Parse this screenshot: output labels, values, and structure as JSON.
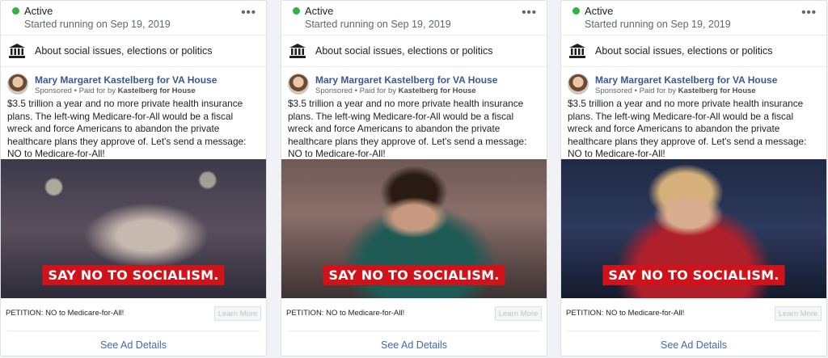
{
  "cards": [
    {
      "status": "Active",
      "started": "Started running on Sep 19, 2019",
      "more_label": "•••",
      "category": "About social issues, elections or politics",
      "advertiser": "Mary Margaret Kastelberg for VA House",
      "sponsored": "Sponsored",
      "paid_prefix": "Paid for by",
      "paid_by": "Kastelberg for House",
      "body": "$3.5 trillion a year and no more private health insurance plans. The left-wing Medicare-for-All would be a fiscal wreck and force Americans to abandon the private healthcare plans they approve of. Let's send a message: NO to Medicare-for-All!",
      "image_caption": "SAY NO TO SOCIALISM.",
      "cta_text": "PETITION: NO to Medicare-for-All!",
      "cta_button": "Learn More",
      "details_link": "See Ad Details"
    },
    {
      "status": "Active",
      "started": "Started running on Sep 19, 2019",
      "more_label": "•••",
      "category": "About social issues, elections or politics",
      "advertiser": "Mary Margaret Kastelberg for VA House",
      "sponsored": "Sponsored",
      "paid_prefix": "Paid for by",
      "paid_by": "Kastelberg for House",
      "body": "$3.5 trillion a year and no more private health insurance plans. The left-wing Medicare-for-All would be a fiscal wreck and force Americans to abandon the private healthcare plans they approve of. Let's send a message: NO to Medicare-for-All!",
      "image_caption": "SAY NO TO SOCIALISM.",
      "cta_text": "PETITION: NO to Medicare-for-All!",
      "cta_button": "Learn More",
      "details_link": "See Ad Details"
    },
    {
      "status": "Active",
      "started": "Started running on Sep 19, 2019",
      "more_label": "•••",
      "category": "About social issues, elections or politics",
      "advertiser": "Mary Margaret Kastelberg for VA House",
      "sponsored": "Sponsored",
      "paid_prefix": "Paid for by",
      "paid_by": "Kastelberg for House",
      "body": "$3.5 trillion a year and no more private health insurance plans. The left-wing Medicare-for-All would be a fiscal wreck and force Americans to abandon the private healthcare plans they approve of. Let's send a message: NO to Medicare-for-All!",
      "image_caption": "SAY NO TO SOCIALISM.",
      "cta_text": "PETITION: NO to Medicare-for-All!",
      "cta_button": "Learn More",
      "details_link": "See Ad Details"
    }
  ],
  "icons": {
    "category": "bank-building-icon",
    "status": "active-dot-icon",
    "more": "more-dots-icon"
  },
  "colors": {
    "active": "#2fb344",
    "link": "#385898",
    "banner": "#d0131b"
  }
}
